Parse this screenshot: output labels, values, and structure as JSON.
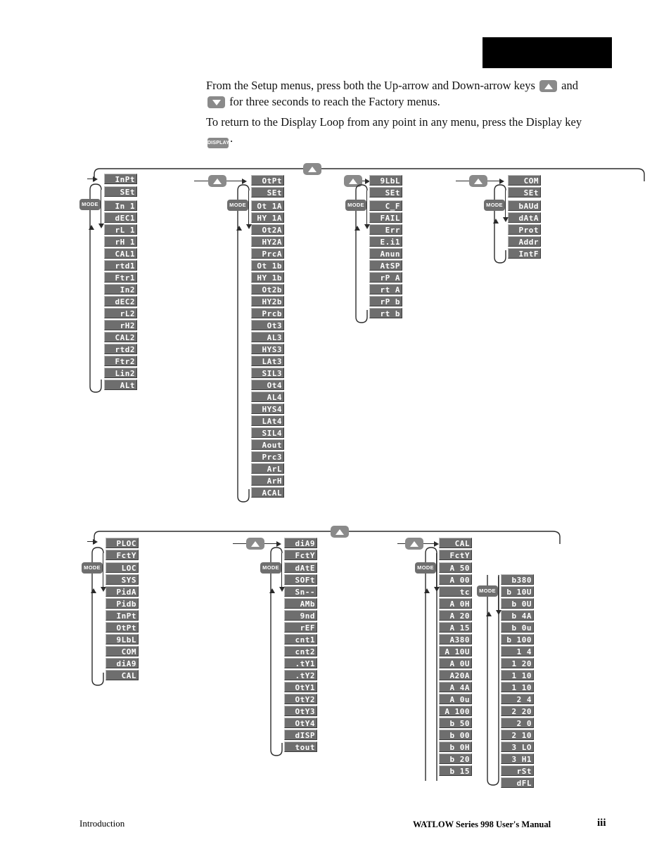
{
  "intro": {
    "para1_a": "From the Setup menus, press both the Up-arrow and Down-arrow keys",
    "para1_b": "and",
    "para1_c": "for three seconds to reach the Factory menus.",
    "para2_a": "To return to the Display Loop from any point in any menu, press the Display key",
    "para2_b": ".",
    "key_up": "up-arrow-key",
    "key_down": "down-arrow-key",
    "key_display_label": "DISPLAY"
  },
  "mode_label": "MODE",
  "colors": {
    "led_background": "#6e6e6e",
    "led_text": "#ffffff",
    "key_background": "#8a8a8a",
    "line": "#2a2a2a",
    "redaction_bar": "#000000"
  },
  "setup_map": {
    "columns": [
      {
        "id": "input",
        "header": "InPt",
        "subheader": "SEt",
        "items": [
          "In 1",
          "dEC1",
          "rL 1",
          "rH 1",
          "CAL1",
          "rtd1",
          "Ftr1",
          "In2",
          "dEC2",
          "rL2",
          "rH2",
          "CAL2",
          "rtd2",
          "Ftr2",
          "Lin2",
          "ALt"
        ]
      },
      {
        "id": "output",
        "header": "OtPt",
        "subheader": "SEt",
        "items": [
          "Ot 1A",
          "HY 1A",
          "Ot2A",
          "HY2A",
          "PrcA",
          "Ot 1b",
          "HY 1b",
          "Ot2b",
          "HY2b",
          "Prcb",
          "Ot3",
          "AL3",
          "HYS3",
          "LAt3",
          "SIL3",
          "Ot4",
          "AL4",
          "HYS4",
          "LAt4",
          "SIL4",
          "Aout",
          "Prc3",
          "ArL",
          "ArH",
          "ACAL"
        ]
      },
      {
        "id": "global",
        "header": "9LbL",
        "subheader": "SEt",
        "items": [
          "C_F",
          "FAIL",
          "Err",
          "E.i1",
          "Anun",
          "AtSP",
          "rP A",
          "rt A",
          "rP b",
          "rt b"
        ]
      },
      {
        "id": "comm",
        "header": "COM",
        "subheader": "SEt",
        "items": [
          "bAUd",
          "dAtA",
          "Prot",
          "Addr",
          "IntF"
        ]
      }
    ]
  },
  "factory_map": {
    "columns": [
      {
        "id": "plock",
        "header": "PLOC",
        "subheader": "FctY",
        "items": [
          "LOC",
          "SYS",
          "PidA",
          "Pidb",
          "InPt",
          "OtPt",
          "9LbL",
          "COM",
          "diA9",
          "CAL"
        ]
      },
      {
        "id": "diagnostics",
        "header": "diA9",
        "subheader": "FctY",
        "items": [
          "dAtE",
          "SOFt",
          "Sn--",
          "AMb",
          "9nd",
          "rEF",
          "cnt1",
          "cnt2",
          ".tY1",
          ".tY2",
          "OtY1",
          "OtY2",
          "OtY3",
          "OtY4",
          "dISP",
          "tout"
        ]
      },
      {
        "id": "calibration",
        "header": "CAL",
        "subheader": "FctY",
        "items": [
          "A 50",
          "A 00",
          "tc",
          "A 0H",
          "A 20",
          "A 15",
          "A380",
          "A 10U",
          "A 0U",
          "A20A",
          "A 4A",
          "A 0u",
          "A 100",
          "b 50",
          "b 00",
          "b 0H",
          "b 20",
          "b 15"
        ]
      },
      {
        "id": "calibration2",
        "header": "",
        "subheader": "",
        "items": [
          "b380",
          "b 10U",
          "b 0U",
          "b 4A",
          "b 0u",
          "b 100",
          "1 4",
          "1 20",
          "1 10",
          "1 10",
          "2 4",
          "2 20",
          "2 0",
          "2 10",
          "3 LO",
          "3 H1",
          "rSt",
          "dFL"
        ]
      }
    ]
  },
  "footer": {
    "left": "Introduction",
    "right": "WATLOW Series 998 User's Manual",
    "page": "iii"
  }
}
